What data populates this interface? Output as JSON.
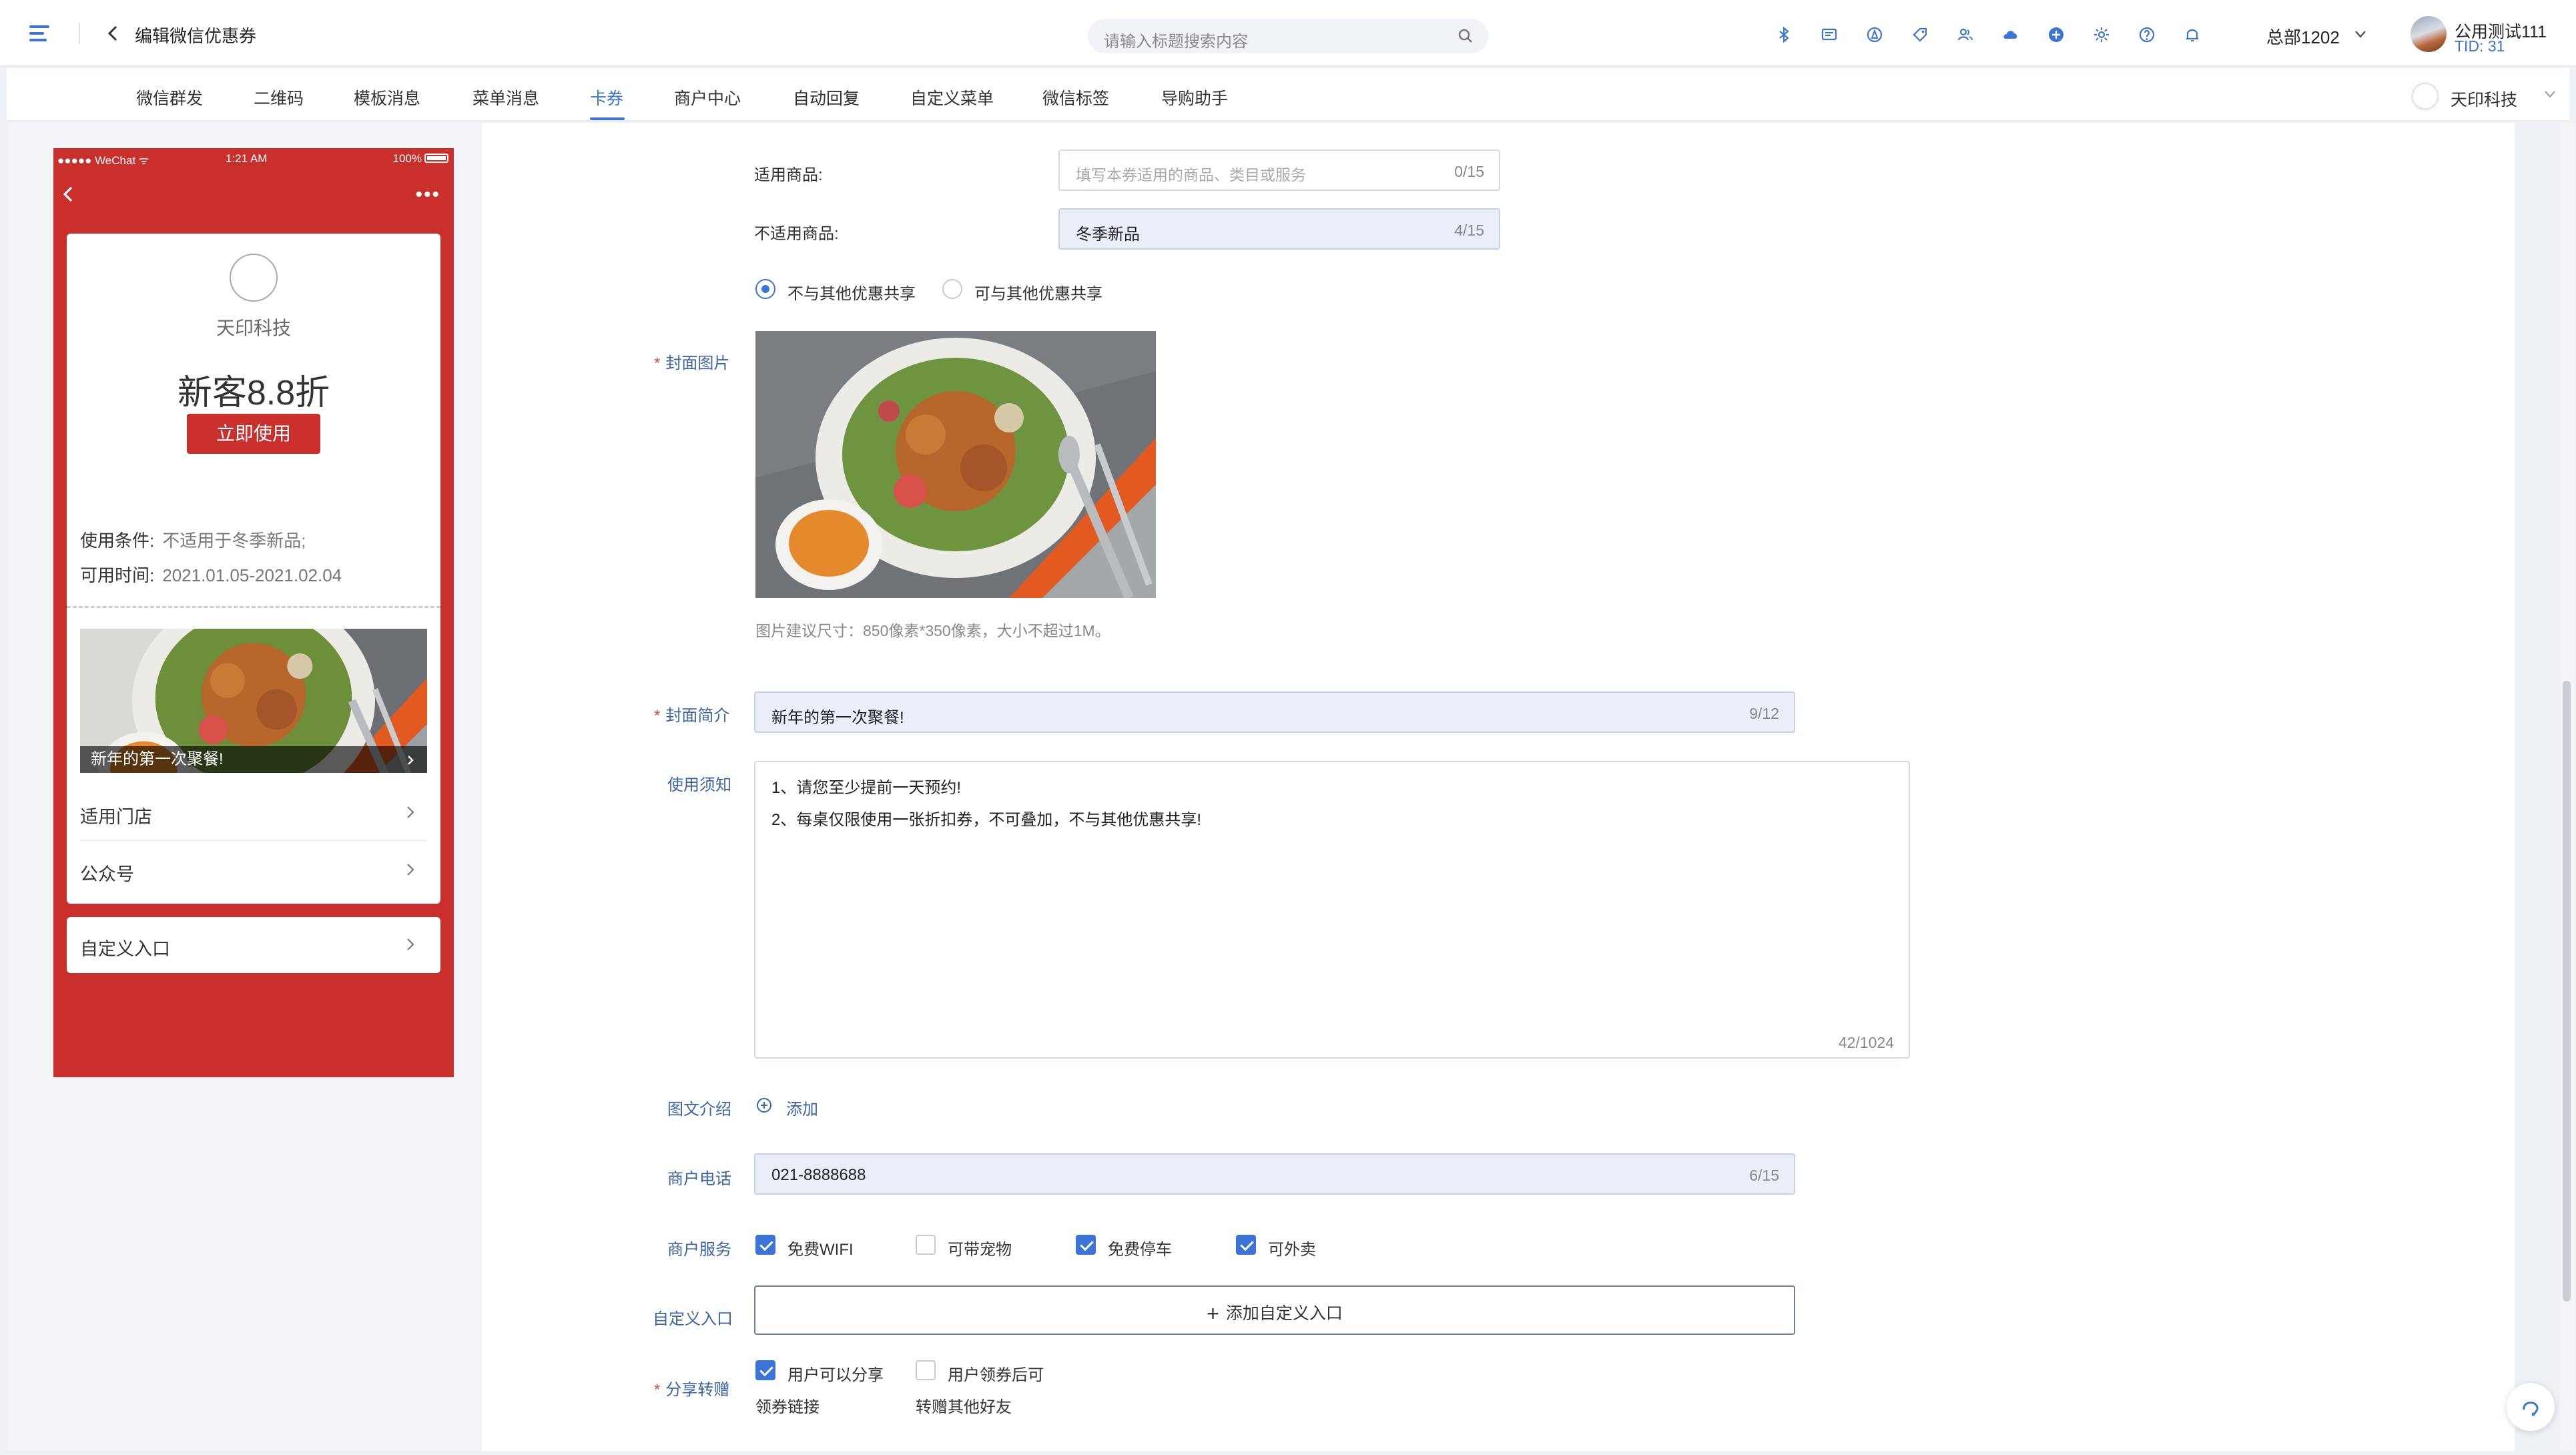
{
  "header": {
    "title": "编辑微信优惠券",
    "search_placeholder": "请输入标题搜索内容",
    "org": "总部1202",
    "user_name": "公用测试111",
    "user_tid": "TID: 31"
  },
  "tabs": [
    {
      "label": "微信群发"
    },
    {
      "label": "二维码"
    },
    {
      "label": "模板消息"
    },
    {
      "label": "菜单消息"
    },
    {
      "label": "卡券",
      "active": true
    },
    {
      "label": "商户中心"
    },
    {
      "label": "自动回复"
    },
    {
      "label": "自定义菜单"
    },
    {
      "label": "微信标签"
    },
    {
      "label": "导购助手"
    }
  ],
  "company": "天印科技",
  "preview": {
    "status_left": "●●●●● WeChat ᯤ",
    "status_time": "1:21 AM",
    "status_battery": "100%",
    "more": "•••",
    "merchant": "天印科技",
    "title": "新客8.8折",
    "use_button": "立即使用",
    "cond_label": "使用条件:",
    "cond_value": "不适用于冬季新品;",
    "time_label": "可用时间:",
    "time_value": "2021.01.05-2021.02.04",
    "cover_caption": "新年的第一次聚餐!",
    "rows": [
      "适用门店",
      "公众号"
    ],
    "custom_entry": "自定义入口"
  },
  "form": {
    "applicable_label": "适用商品:",
    "applicable_placeholder": "填写本券适用的商品、类目或服务",
    "applicable_count": "0/15",
    "not_applicable_label": "不适用商品:",
    "not_applicable_value": "冬季新品",
    "not_applicable_count": "4/15",
    "share_options": [
      {
        "label": "不与其他优惠共享",
        "selected": true
      },
      {
        "label": "可与其他优惠共享",
        "selected": false
      }
    ],
    "cover_label": "封面图片",
    "cover_hint": "图片建议尺寸：850像素*350像素，大小不超过1M。",
    "intro_label": "封面简介",
    "intro_value": "新年的第一次聚餐!",
    "intro_count": "9/12",
    "notice_label": "使用须知",
    "notice_lines": [
      "1、请您至少提前一天预约!",
      "2、每桌仅限使用一张折扣券，不可叠加，不与其他优惠共享!"
    ],
    "notice_count": "42/1024",
    "article_label": "图文介绍",
    "article_add": "添加",
    "phone_label": "商户电话",
    "phone_value": "021-8888688",
    "phone_count": "6/15",
    "services_label": "商户服务",
    "services": [
      {
        "label": "免费WIFI",
        "checked": true
      },
      {
        "label": "可带宠物",
        "checked": false
      },
      {
        "label": "免费停车",
        "checked": true
      },
      {
        "label": "可外卖",
        "checked": true
      }
    ],
    "custom_entry_label": "自定义入口",
    "custom_entry_button": "添加自定义入口",
    "share_label": "分享转赠",
    "share_checks": [
      {
        "line1": "用户可以分享",
        "line2": "领券链接",
        "checked": true
      },
      {
        "line1": "用户领券后可",
        "line2": "转赠其他好友",
        "checked": false
      }
    ]
  },
  "colors": {
    "accent": "#3b73d6",
    "brand_red": "#c9302c",
    "required": "#e04848"
  },
  "icons": [
    "menu-icon",
    "back-arrow-icon",
    "search-icon",
    "bluetooth-icon",
    "message-icon",
    "compass-icon",
    "tag-icon",
    "users-icon",
    "cloud-icon",
    "plus-circle-icon",
    "gear-icon",
    "help-icon",
    "bell-icon",
    "chevron-down-icon",
    "chevron-right-icon",
    "headset-icon"
  ]
}
